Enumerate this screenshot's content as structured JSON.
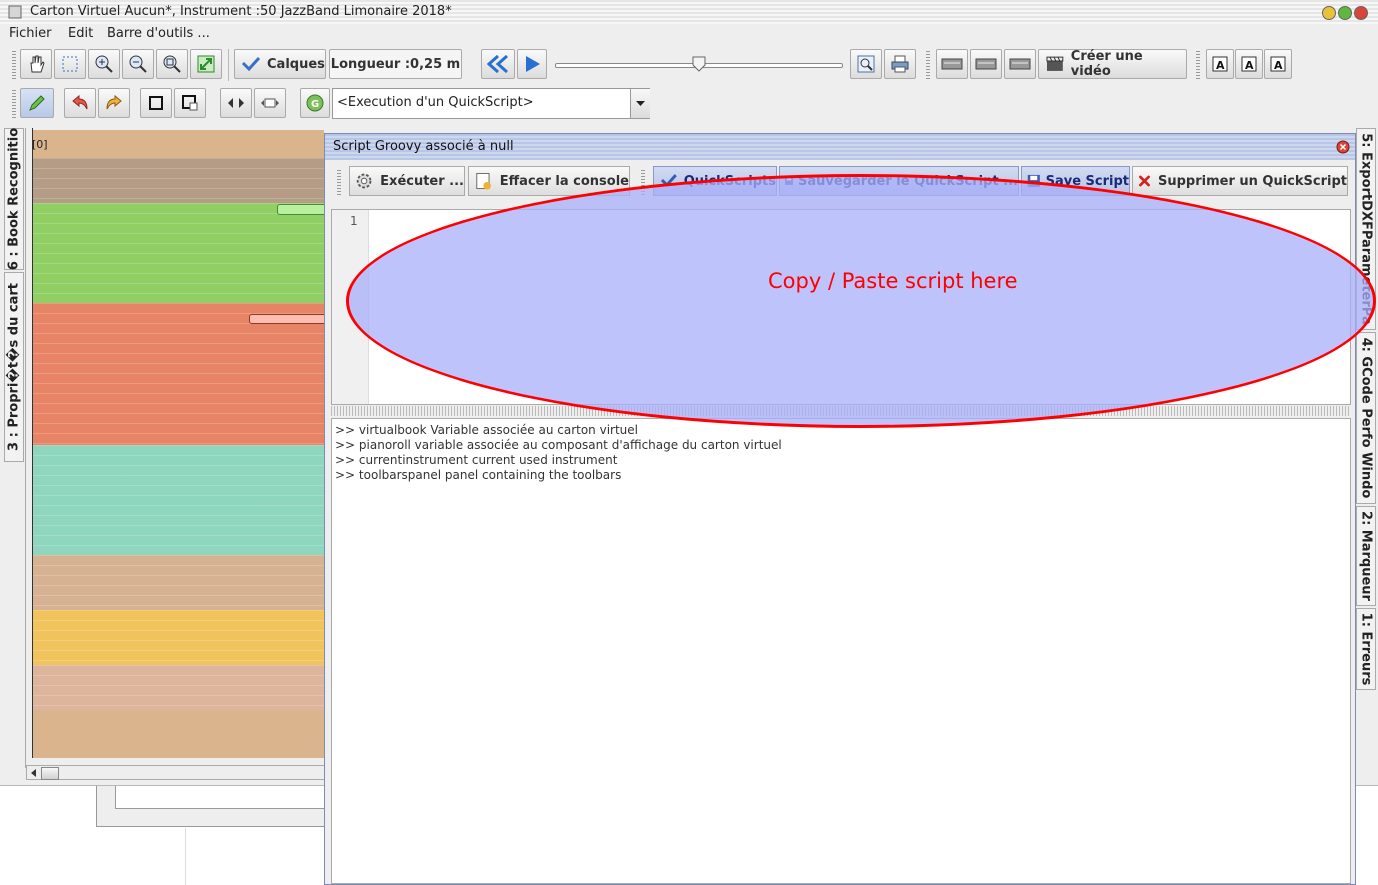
{
  "window": {
    "title": "Carton Virtuel  Aucun*, Instrument :50 JazzBand Limonaire 2018*"
  },
  "menu": [
    "Fichier",
    "Edit",
    "Barre d'outils ..."
  ],
  "toolbar1": {
    "calques_label": "Calques",
    "length_label": "Longueur :0,25 m",
    "slider_value": 0.5,
    "create_video_label": "Créer une vidéo"
  },
  "toolbar2": {
    "quickscript_select": "<Execution d'un QuickScript>"
  },
  "left_tabs": [
    "6 : Book Recognitio",
    "3 : Propri�t�s du cart"
  ],
  "right_tabs": [
    "5: ExportDXFParameterPa",
    "4: GCode Perfo Windo",
    "2: Marqueur",
    "1: Erreurs"
  ],
  "pianoroll": {
    "marker": "[0]"
  },
  "dialog": {
    "title": "Script Groovy associé à null",
    "buttons": {
      "execute": "Exécuter ...",
      "clear_console": "Effacer la console",
      "quickscripts": "QuickScripts",
      "save_quickscript": "Sauvegarder le QuickScript ...",
      "save_script": "Save Script",
      "delete_quickscript": "Supprimer un QuickScript"
    },
    "editor": {
      "line_number": "1",
      "annotation": "Copy / Paste script here"
    },
    "console_lines": [
      ">>  virtualbook Variable associée au carton virtuel",
      ">>  pianoroll variable associée au composant d'affichage du carton virtuel",
      ">>  currentinstrument current used instrument",
      ">>  toolbarspanel panel containing the toolbars"
    ]
  },
  "colors": {
    "annotation": "#ff0000",
    "highlight": "#b8bcf8",
    "band_green": "#8fcf63",
    "band_red": "#e88466",
    "band_teal": "#8fd6bf",
    "band_tan": "#d9b48d",
    "band_yellow": "#f0c35c"
  }
}
